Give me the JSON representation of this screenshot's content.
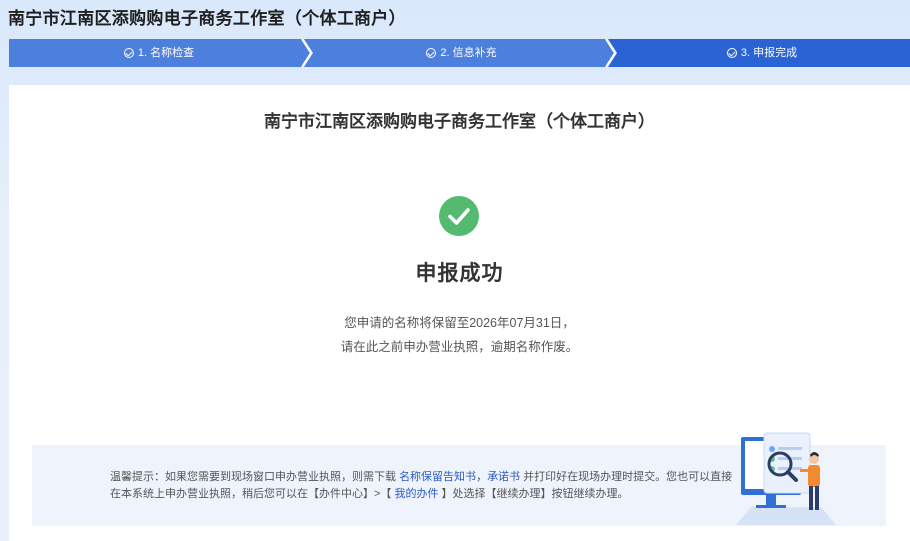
{
  "page": {
    "title": "南宁市江南区添购购电子商务工作室（个体工商户）"
  },
  "steps": [
    {
      "label": "1. 名称检查",
      "state": "done"
    },
    {
      "label": "2. 信息补充",
      "state": "done"
    },
    {
      "label": "3. 申报完成",
      "state": "current"
    }
  ],
  "colors": {
    "step_done": "#4d7fdc",
    "step_current": "#2a63d4",
    "success_green": "#53ba6f",
    "link_blue": "#2a5bc7"
  },
  "main": {
    "company_title": "南宁市江南区添购购电子商务工作室（个体工商户）",
    "success_icon": "check-circle-icon",
    "success_title": "申报成功",
    "message_line1": "您申请的名称将保留至2026年07月31日，",
    "message_line2": "请在此之前申办营业执照，逾期名称作废。"
  },
  "tip": {
    "prefix": "温馨提示：如果您需要到现场窗口申办营业执照，则需下载 ",
    "link_notice": "名称保留告知书",
    "comma": "，",
    "link_promise": "承诺书",
    "middle": " 并打印好在现场办理时提交。您也可以直接在本系统上申办营业执照，稍后您可以在【办件中心】>【 ",
    "link_my_cases": "我的办件",
    "suffix": " 】处选择【继续办理】按钮继续办理。"
  }
}
